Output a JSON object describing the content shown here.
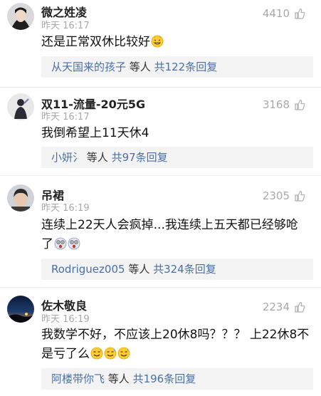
{
  "comments": [
    {
      "username": "微之姓凌",
      "time": "昨天 16:17",
      "likes": "4410",
      "text": "还是正常双休比较好",
      "reply": {
        "from": "从天国来的孩子",
        "mid": " 等人 ",
        "count": "共122条回复"
      }
    },
    {
      "username": "双11-流量-20元5G",
      "time": "昨天 16:17",
      "likes": "3168",
      "text": "我倒希望上11天休4",
      "reply": {
        "from": "小妍氵",
        "mid": " 等人 ",
        "count": "共97条回复"
      }
    },
    {
      "username": "吊裙",
      "time": "昨天 16:19",
      "likes": "2305",
      "text_line1": "连续上22天人会疯掉...我连续上五天都已经够呛",
      "text_line2": "了",
      "reply": {
        "from": "Rodriguez005",
        "mid": " 等人 ",
        "count": "共324条回复"
      }
    },
    {
      "username": "佐木敬良",
      "time": "昨天 16:19",
      "likes": "2234",
      "text_line1": "我数学不好，不应该上20休8吗？？？ 上22休8不",
      "text_line2": "是亏了么",
      "reply": {
        "from": "阿楼带你飞",
        "mid": " 等人 ",
        "count": "共196条回复"
      }
    }
  ],
  "icons": {
    "like": "thumbs-up-icon",
    "emoji_1": "grinning-face-emoji",
    "emoji_3": "scared-face-emoji",
    "emoji_4": "sweat-smile-emoji"
  },
  "colors": {
    "link": "#4a6fa5",
    "meta": "#a8a8a8",
    "reply_bg": "#f3f3f3"
  }
}
